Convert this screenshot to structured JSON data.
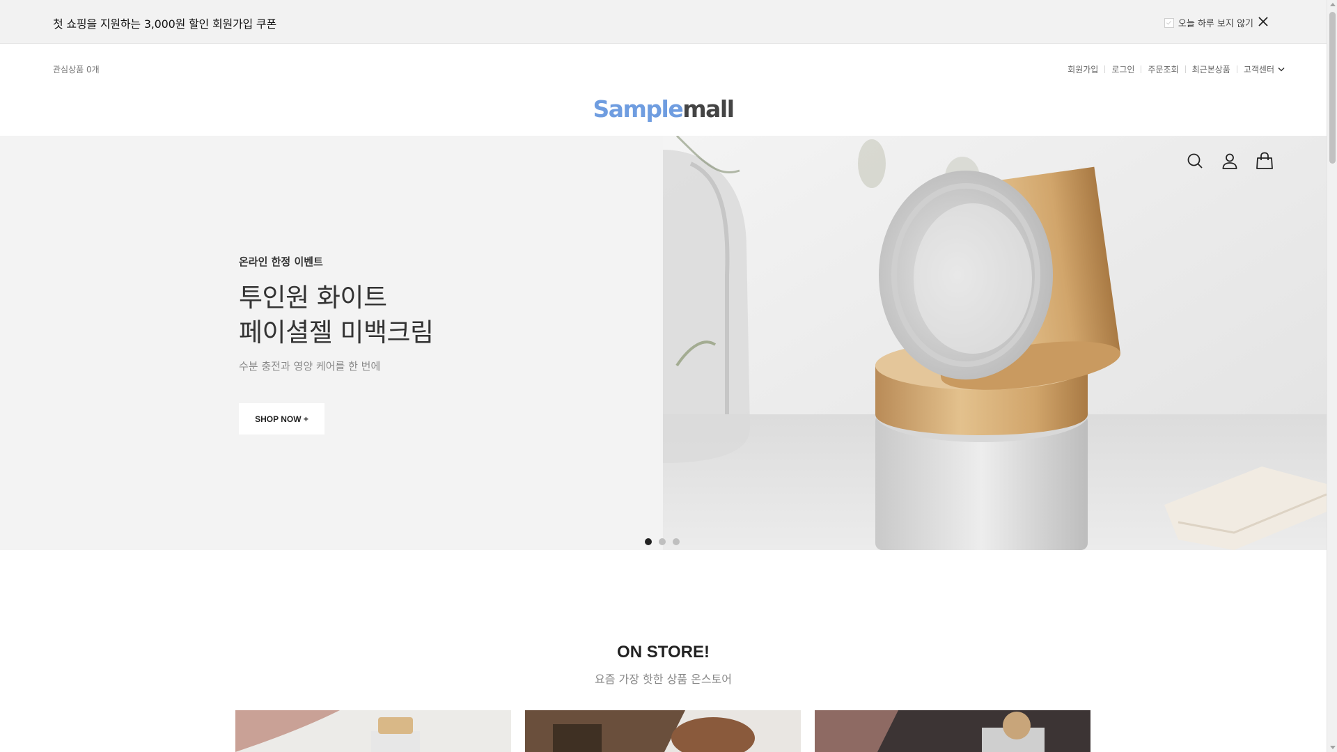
{
  "topbar": {
    "message": "첫 쇼핑을 지원하는 3,000원 할인 회원가입 쿠폰",
    "hide_today_label": "오늘 하루 보지 않기",
    "close_icon": "close-icon"
  },
  "utility": {
    "wishlist": "관심상품 0개",
    "links": [
      "회원가입",
      "로그인",
      "주문조회",
      "최근본상품"
    ],
    "customer_center": "고객센터"
  },
  "logo": {
    "part1": "Sample",
    "part2": "mall",
    "color1": "#6f9de0",
    "color2": "#444444"
  },
  "hero": {
    "eyebrow": "온라인 한정 이벤트",
    "title_line1": "투인원 화이트",
    "title_line2": "페이셜젤 미백크림",
    "subtitle": "수분 충전과 영양 케어를 한 번에",
    "button": "SHOP NOW +",
    "icons": [
      "search-icon",
      "user-icon",
      "shopping-bag-icon"
    ],
    "slides_total": 3,
    "active_slide": 1
  },
  "store": {
    "title": "ON STORE!",
    "subtitle": "요즘 가장 핫한 상품 온스토어"
  }
}
